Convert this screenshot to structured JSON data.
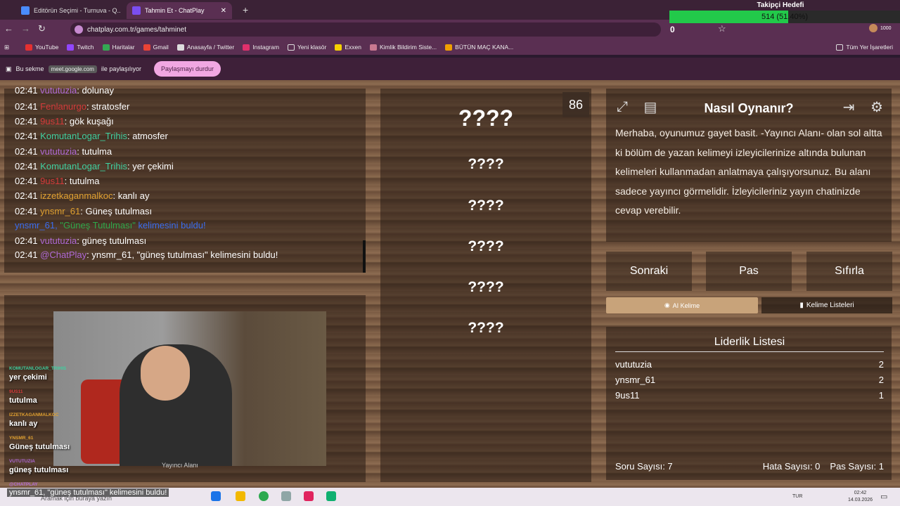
{
  "browser": {
    "tabs": [
      {
        "label": "Editörün Seçimi - Turnuva - Q..."
      },
      {
        "label": "Tahmin Et - ChatPlay"
      }
    ],
    "url": "chatplay.com.tr/games/tahminet",
    "bookmarks": [
      "YouTube",
      "Twitch",
      "Haritalar",
      "Gmail",
      "Anasayfa / Twitter",
      "Instagram",
      "Yeni klasör",
      "Exxen",
      "Kimlik Bildirim Siste...",
      "BÜTÜN MAÇ KANA..."
    ],
    "all_bookmarks": "Tüm Yer İşaretleri",
    "profile_count": "1000"
  },
  "share": {
    "prefix": "Bu sekme",
    "host": "meet.google.com",
    "suffix": "ile paylaşılıyor",
    "stop_label": "Paylaşmayı durdur"
  },
  "goal": {
    "title": "Takipçi Hedefi",
    "text": "514 (51.40%)",
    "fraction": 0.514,
    "zero": "0"
  },
  "chat": [
    {
      "time": "02:41",
      "user": "vututuzia",
      "text": ": dolunay",
      "color": "#b06ad6"
    },
    {
      "time": "02:41",
      "user": "Fenlanurgo",
      "text": ": stratosfer",
      "color": "#d43a3a"
    },
    {
      "time": "02:41",
      "user": "9us11",
      "text": ": gök kuşağı",
      "color": "#d43a3a"
    },
    {
      "time": "02:41",
      "user": "KomutanLogar_Trihis",
      "text": ": atmosfer",
      "color": "#3fd0a0"
    },
    {
      "time": "02:41",
      "user": "vututuzia",
      "text": ": tutulma",
      "color": "#b06ad6"
    },
    {
      "time": "02:41",
      "user": "KomutanLogar_Trihis",
      "text": ": yer çekimi",
      "color": "#3fd0a0"
    },
    {
      "time": "02:41",
      "user": "9us11",
      "text": ": tutulma",
      "color": "#d43a3a"
    },
    {
      "time": "02:41",
      "user": "izzetkaganmalkoc",
      "text": ": kanlı ay",
      "color": "#e0a030"
    },
    {
      "time": "02:41",
      "user": "ynsmr_61",
      "text": ": Güneş tutulması",
      "color": "#e0a030"
    }
  ],
  "found": {
    "user": "ynsmr_61,",
    "word": "\"Güneş Tutulması\"",
    "rest": "kelimesini buldu!"
  },
  "chat_tail": [
    {
      "time": "02:41",
      "user": "vututuzia",
      "text": ": güneş tutulması",
      "color": "#b06ad6"
    },
    {
      "time": "02:41",
      "user": "@ChatPlay",
      "text": ": ynsmr_61, \"güneş tutulması\" kelimesini buldu!",
      "color": "#b06ad6"
    }
  ],
  "words": {
    "main": "????",
    "hidden": [
      "????",
      "????",
      "????",
      "????",
      "????"
    ],
    "counter": "86"
  },
  "howto": {
    "title": "Nasıl Oynanır?",
    "text": "Merhaba, oyunumuz gayet basit. -Yayıncı Alanı- olan sol altta ki bölüm de yazan kelimeyi izleyicilerinize altında bulunan kelimeleri kullanmadan anlatmaya çalışıyorsunuz. Bu alanı sadece yayıncı görmelidir. İzleyicileriniz yayın chatinizde cevap verebilir."
  },
  "buttons": {
    "next": "Sonraki",
    "pass": "Pas",
    "reset": "Sıfırla",
    "ai": "AI Kelime",
    "lists": "Kelime Listeleri"
  },
  "leaderboard": {
    "title": "Liderlik Listesi",
    "rows": [
      {
        "name": "vututuzia",
        "score": "2"
      },
      {
        "name": "ynsmr_61",
        "score": "2"
      },
      {
        "name": "9us11",
        "score": "1"
      }
    ]
  },
  "stats": {
    "questions": "Soru Sayısı: 7",
    "errors": "Hata Sayısı: 0",
    "passes": "Pas Sayısı: 1"
  },
  "overlay": [
    {
      "user": "KOMUTANLOGAR_TRIHIS",
      "text": "yer çekimi",
      "color": "#3fd0a0"
    },
    {
      "user": "9US11",
      "text": "tutulma",
      "color": "#d43a3a"
    },
    {
      "user": "IZZETKAGANMALKOC",
      "text": "kanlı ay",
      "color": "#e0a030"
    },
    {
      "user": "YNSMR_61",
      "text": "Güneş tutulması",
      "color": "#e0a030"
    },
    {
      "user": "VUTUTUZIA",
      "text": "güneş tutulması",
      "color": "#b06ad6"
    }
  ],
  "overlay_chatplay": "@CHATPLAY",
  "toast": "ynsmr_61, \"güneş tutulması\" kelimesini buldu!",
  "cam_caption": "Yayıncı Alanı",
  "taskbar": {
    "search": "Aramak için buraya yazın",
    "lang": "TUR",
    "time": "02:42",
    "date": "14.03.2026"
  }
}
